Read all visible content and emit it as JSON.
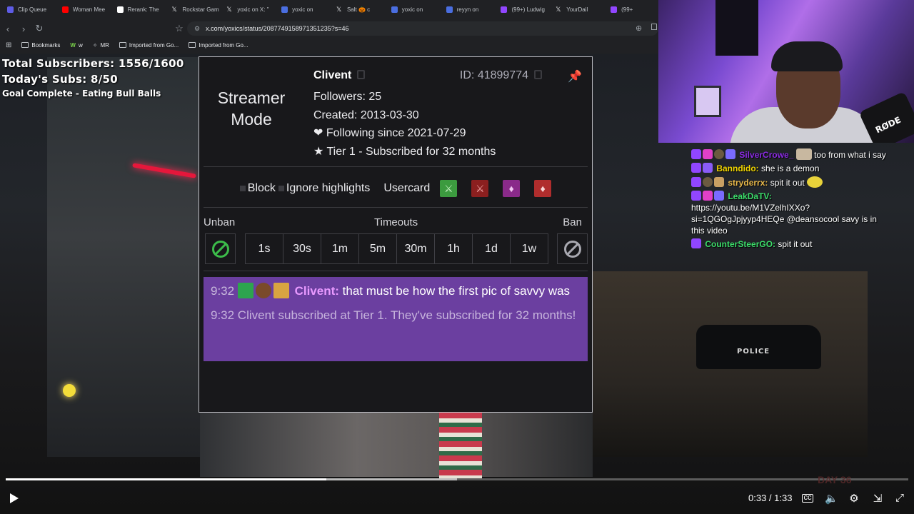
{
  "browser": {
    "tabs": [
      {
        "label": "Clip Queue",
        "color": "#5e5ce6"
      },
      {
        "label": "Woman Mee",
        "color": "#ff0000"
      },
      {
        "label": "Rerank: The",
        "color": "#ffffff"
      },
      {
        "label": "Rockstar Gam",
        "color": "x"
      },
      {
        "label": "yoxic on X: \"",
        "color": "x"
      },
      {
        "label": "yoxic on",
        "color": "#4a6ee0"
      },
      {
        "label": "Salt 🎃 c",
        "color": "x"
      },
      {
        "label": "yoxic on",
        "color": "#4a6ee0"
      },
      {
        "label": "reyyn on",
        "color": "#4a6ee0"
      },
      {
        "label": "(99+) Ludwig",
        "color": "#9146ff"
      },
      {
        "label": "YourDail",
        "color": "x"
      },
      {
        "label": "(99+",
        "color": "#9146ff"
      }
    ],
    "url": "x.com/yoxics/status/2087749158971351235?s=46",
    "bookmarks": [
      "Bookmarks",
      "w",
      "MR",
      "Imported from Go...",
      "Imported from Go..."
    ]
  },
  "subgoal": {
    "total": "Total Subscribers: 1556/1600",
    "today": "Today's Subs: 8/50",
    "goal": "Goal Complete - Eating Bull Balls"
  },
  "webcam": {
    "mic_brand": "RØDE"
  },
  "chat": [
    {
      "user": "SilverCrowe_",
      "user_color": "#8a2be2",
      "text": "too from what i say"
    },
    {
      "user": "Banndido:",
      "user_color": "#f2d600",
      "text": "she is a demon"
    },
    {
      "user": "stryderrx:",
      "user_color": "#e8b84a",
      "text": "spit it out"
    },
    {
      "user": "LeakDaTV:",
      "user_color": "#3cdd6a",
      "text": "https://youtu.be/M1VZelhIXXo?si=1QGOgJpjyyp4HEQe @deansocool savy is in this video"
    },
    {
      "user": "CounterSteerGO:",
      "user_color": "#3cdd6a",
      "text": "spit it out"
    }
  ],
  "usercard": {
    "streamer_mode": "Streamer Mode",
    "name": "Clivent",
    "id": "ID: 41899774",
    "followers": "Followers: 25",
    "created": "Created: 2013-03-30",
    "following": "❤ Following since 2021-07-29",
    "tier": "★ Tier 1 - Subscribed for 32 months",
    "actions": {
      "block": "Block",
      "ignore": "Ignore highlights",
      "usercard": "Usercard"
    },
    "labels": {
      "unban": "Unban",
      "timeouts": "Timeouts",
      "ban": "Ban"
    },
    "timeouts": [
      "1s",
      "30s",
      "1m",
      "5m",
      "30m",
      "1h",
      "1d",
      "1w"
    ],
    "message": {
      "time": "9:32",
      "user": "Clivent:",
      "text": "that must be how the first pic of savvy was",
      "system": "9:32 Clivent subscribed at Tier 1. They've subscribed for 32 months!"
    }
  },
  "player": {
    "current": "0:33",
    "duration": "1:33",
    "timecode": "0:33 / 1:33",
    "played_fraction": 0.355,
    "buffered_fraction": 0.5
  }
}
